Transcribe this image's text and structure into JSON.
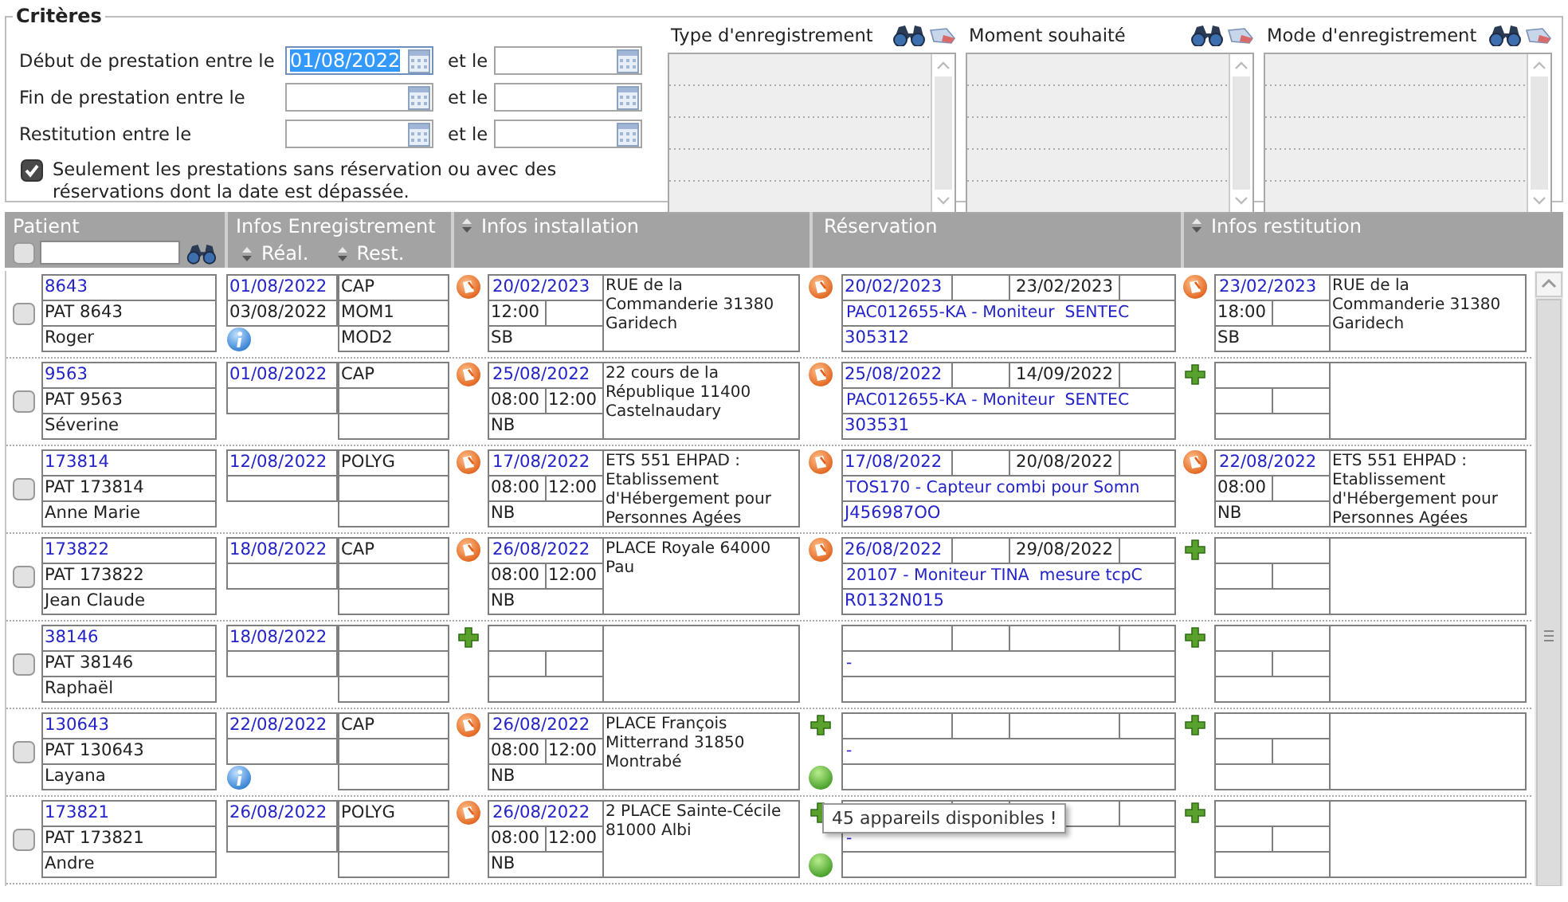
{
  "criteria": {
    "legend": "Critères",
    "date_filters": [
      {
        "label": "Début de prestation entre le",
        "from": "01/08/2022",
        "selected": true,
        "separator": "et le"
      },
      {
        "label": "Fin de prestation entre le",
        "selected": false,
        "separator": "et le"
      },
      {
        "label": "Restitution entre le",
        "selected": false,
        "separator": "et le"
      }
    ],
    "only_unreserved": {
      "label": "Seulement les prestations sans réservation ou avec des réservations dont la date est dépassée.",
      "checked": true
    },
    "lists": [
      {
        "title": "Type d'enregistrement"
      },
      {
        "title": "Moment souhaité"
      },
      {
        "title": "Mode d'enregistrement"
      }
    ]
  },
  "table": {
    "select_all": {
      "checked": false
    },
    "columns": [
      {
        "kind": "patient",
        "label": "Patient"
      },
      {
        "kind": "split",
        "label": "Infos Enregistrement",
        "sub": [
          "Réal.",
          "Rest."
        ]
      },
      {
        "kind": "sortable",
        "label": "Infos installation"
      },
      {
        "kind": "plain",
        "label": "Réservation"
      },
      {
        "kind": "sortable",
        "label": "Infos restitution"
      }
    ],
    "rows": [
      {
        "checked": false,
        "patient": {
          "id": "8643",
          "code": "PAT 8643",
          "name": "Roger"
        },
        "enregistrement": {
          "real": "01/08/2022",
          "rest": "03/08/2022",
          "info": true,
          "type": "CAP",
          "moment": "MOM1",
          "mode": "MOD2"
        },
        "installation": {
          "kind": "edit",
          "date": "20/02/2023",
          "start": "12:00",
          "code": "SB",
          "address": "RUE de la Commanderie 31380 Garidech"
        },
        "reservation": {
          "kind": "edit",
          "available": false,
          "start": "20/02/2023",
          "end": "23/02/2023",
          "device": "PAC012655-KA - Moniteur  SENTEC",
          "serial": "305312"
        },
        "restitution": {
          "kind": "edit",
          "date": "23/02/2023",
          "start": "18:00",
          "code": "SB",
          "address": "RUE de la Commanderie 31380 Garidech"
        }
      },
      {
        "checked": false,
        "patient": {
          "id": "9563",
          "code": "PAT 9563",
          "name": "Séverine"
        },
        "enregistrement": {
          "real": "01/08/2022",
          "info": false,
          "type": "CAP"
        },
        "installation": {
          "kind": "edit",
          "date": "25/08/2022",
          "start": "08:00",
          "end": "12:00",
          "code": "NB",
          "address": "22 cours de la République 11400 Castelnaudary"
        },
        "reservation": {
          "kind": "edit",
          "available": false,
          "start": "25/08/2022",
          "end": "14/09/2022",
          "device": "PAC012655-KA - Moniteur  SENTEC",
          "serial": "303531"
        },
        "restitution": {
          "kind": "add"
        }
      },
      {
        "checked": false,
        "patient": {
          "id": "173814",
          "code": "PAT 173814",
          "name": "Anne Marie"
        },
        "enregistrement": {
          "real": "12/08/2022",
          "info": false,
          "type": "POLYG"
        },
        "installation": {
          "kind": "edit",
          "date": "17/08/2022",
          "start": "08:00",
          "end": "12:00",
          "code": "NB",
          "address": "ETS 551 EHPAD : Etablissement d'Hébergement pour Personnes Agées"
        },
        "reservation": {
          "kind": "edit",
          "available": false,
          "start": "17/08/2022",
          "end": "20/08/2022",
          "device": "TOS170 - Capteur combi pour Somn",
          "serial": "J456987OO"
        },
        "restitution": {
          "kind": "edit",
          "date": "22/08/2022",
          "start": "08:00",
          "code": "NB",
          "address": "ETS 551 EHPAD : Etablissement d'Hébergement pour Personnes Agées"
        }
      },
      {
        "checked": false,
        "patient": {
          "id": "173822",
          "code": "PAT 173822",
          "name": "Jean Claude"
        },
        "enregistrement": {
          "real": "18/08/2022",
          "info": false,
          "type": "CAP"
        },
        "installation": {
          "kind": "edit",
          "date": "26/08/2022",
          "start": "08:00",
          "end": "12:00",
          "code": "NB",
          "address": "PLACE Royale 64000 Pau"
        },
        "reservation": {
          "kind": "edit",
          "available": false,
          "start": "26/08/2022",
          "end": "29/08/2022",
          "device": "20107 - Moniteur TINA  mesure tcpC",
          "serial": "R0132N015"
        },
        "restitution": {
          "kind": "add"
        }
      },
      {
        "checked": false,
        "patient": {
          "id": "38146",
          "code": "PAT 38146",
          "name": "Raphaël"
        },
        "enregistrement": {
          "real": "18/08/2022",
          "info": false
        },
        "installation": {
          "kind": "add"
        },
        "reservation": {
          "kind": "none",
          "available": false,
          "device": "-"
        },
        "restitution": {
          "kind": "add"
        }
      },
      {
        "checked": false,
        "patient": {
          "id": "130643",
          "code": "PAT 130643",
          "name": "Layana"
        },
        "enregistrement": {
          "real": "22/08/2022",
          "info": true,
          "type": "CAP"
        },
        "installation": {
          "kind": "edit",
          "date": "26/08/2022",
          "start": "08:00",
          "end": "12:00",
          "code": "NB",
          "address": "PLACE François Mitterrand 31850 Montrabé"
        },
        "reservation": {
          "kind": "add",
          "available": true,
          "device": "-"
        },
        "restitution": {
          "kind": "add"
        }
      },
      {
        "checked": false,
        "patient": {
          "id": "173821",
          "code": "PAT 173821",
          "name": "Andre"
        },
        "enregistrement": {
          "real": "26/08/2022",
          "info": false,
          "type": "POLYG"
        },
        "installation": {
          "kind": "edit",
          "date": "26/08/2022",
          "start": "08:00",
          "end": "12:00",
          "code": "NB",
          "address": "2 PLACE Sainte-Cécile 81000 Albi"
        },
        "reservation": {
          "kind": "add",
          "available": true,
          "device": "-",
          "tooltip": "45 appareils disponibles !"
        },
        "restitution": {
          "kind": "add"
        }
      }
    ]
  }
}
